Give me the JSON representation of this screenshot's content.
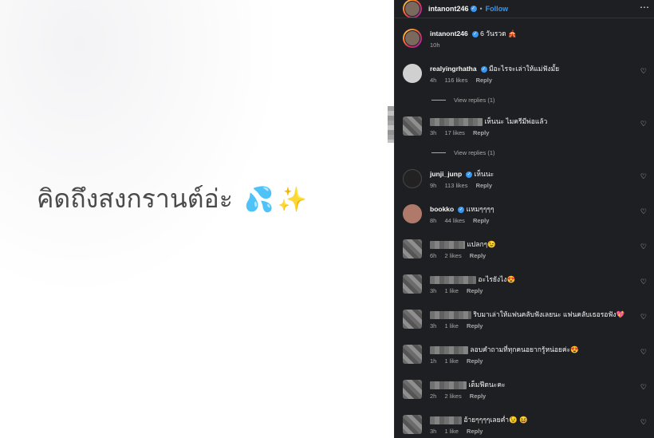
{
  "post": {
    "caption_text": "คิดถึงสงกรานต์อ่ะ",
    "caption_emojis": [
      "💦",
      "✨"
    ]
  },
  "header": {
    "username": "intanont246",
    "separator": "•",
    "follow_label": "Follow",
    "more_icon": "⋯"
  },
  "caption": {
    "username": "intanont246",
    "text": "6 วันรวด",
    "emoji": "🎪",
    "time": "10h"
  },
  "comments": [
    {
      "username": "realyingrhatha",
      "verified": true,
      "blurred": false,
      "text": "มือะไรจะเล่าให้แม่ฟังมั้ย",
      "time": "4h",
      "likes": "116 likes",
      "reply": "Reply",
      "view_replies": "View replies (1)"
    },
    {
      "username": "",
      "verified": false,
      "blurred": true,
      "text": "เห็นนะ ไมครีมีพ่อแล้ว",
      "time": "3h",
      "likes": "17 likes",
      "reply": "Reply",
      "view_replies": "View replies (1)"
    },
    {
      "username": "junji_junp",
      "verified": true,
      "blurred": false,
      "text": "เห็นนะ",
      "time": "9h",
      "likes": "113 likes",
      "reply": "Reply"
    },
    {
      "username": "bookko",
      "verified": true,
      "blurred": false,
      "text": "แหมๆๆๆๆ",
      "time": "8h",
      "likes": "44 likes",
      "reply": "Reply"
    },
    {
      "username": "",
      "verified": false,
      "blurred": true,
      "text": "แปลกๆ😉",
      "time": "6h",
      "likes": "2 likes",
      "reply": "Reply"
    },
    {
      "username": "",
      "verified": false,
      "blurred": true,
      "text": "อะไรยังไง😍",
      "time": "3h",
      "likes": "1 like",
      "reply": "Reply"
    },
    {
      "username": "",
      "verified": false,
      "blurred": true,
      "text": "ริบมาเล่าให้แฟนคลับฟังเลยนะ แฟนคลับเธอรอฟัง💖",
      "time": "3h",
      "likes": "1 like",
      "reply": "Reply"
    },
    {
      "username": "",
      "verified": false,
      "blurred": true,
      "text": "ลอบคำถามที่ทุกคนอยากรู้หน่อยค่ะ😍",
      "time": "1h",
      "likes": "1 like",
      "reply": "Reply"
    },
    {
      "username": "",
      "verified": false,
      "blurred": true,
      "text": "เต็มฟีดนะคะ",
      "time": "2h",
      "likes": "2 likes",
      "reply": "Reply"
    },
    {
      "username": "",
      "verified": false,
      "blurred": true,
      "text": "อ้ายๆๆๆๆเลยค่ำ😉 😆",
      "time": "3h",
      "likes": "1 like",
      "reply": "Reply"
    }
  ],
  "icons": {
    "heart": "♡",
    "verified": "✓"
  },
  "colors": {
    "panel_bg": "#1e1f22",
    "link": "#3897f0",
    "muted": "#a8a8a8"
  }
}
